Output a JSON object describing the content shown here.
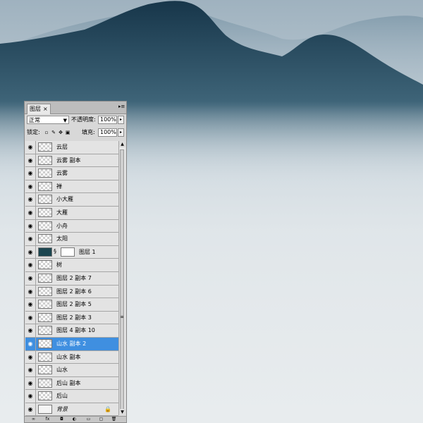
{
  "panel": {
    "tab_label": "图层",
    "close_glyph": "×",
    "menu_glyph": "▸≡",
    "blend_mode": "正常",
    "opacity_label": "不透明度:",
    "opacity_value": "100%",
    "lock_label": "锁定:",
    "fill_label": "填充:",
    "fill_value": "100%"
  },
  "layers": [
    {
      "name": "云层",
      "thumb": "transparent"
    },
    {
      "name": "云雾 副本",
      "thumb": "transparent"
    },
    {
      "name": "云雾",
      "thumb": "transparent"
    },
    {
      "name": "禅",
      "thumb": "transparent"
    },
    {
      "name": "小大雁",
      "thumb": "transparent"
    },
    {
      "name": "大雁",
      "thumb": "transparent"
    },
    {
      "name": "小舟",
      "thumb": "transparent"
    },
    {
      "name": "太阳",
      "thumb": "transparent"
    },
    {
      "name": "图层 1",
      "thumb": "dark",
      "mask": true
    },
    {
      "name": "树",
      "thumb": "transparent"
    },
    {
      "name": "图层 2 副本 7",
      "thumb": "transparent"
    },
    {
      "name": "图层 2 副本 6",
      "thumb": "transparent"
    },
    {
      "name": "图层 2 副本 5",
      "thumb": "transparent"
    },
    {
      "name": "图层 2 副本 3",
      "thumb": "transparent"
    },
    {
      "name": "图层 4 副本 10",
      "thumb": "transparent"
    },
    {
      "name": "山水 副本 2",
      "thumb": "transparent",
      "selected": true
    },
    {
      "name": "山水 副本",
      "thumb": "transparent"
    },
    {
      "name": "山水",
      "thumb": "transparent"
    },
    {
      "name": "后山 副本",
      "thumb": "transparent"
    },
    {
      "name": "后山",
      "thumb": "transparent"
    },
    {
      "name": "背景",
      "thumb": "bg",
      "locked": true,
      "italic": true
    }
  ],
  "colors": {
    "selection": "#3f8fe0",
    "mountain_dark": "#1e4358",
    "mist": "#e6ebee"
  }
}
